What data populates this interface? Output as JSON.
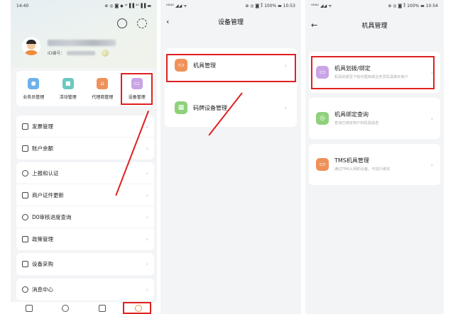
{
  "colors": {
    "accent": "#f08c3c",
    "highlight": "#e02020",
    "purple": "#c9a4e6",
    "green": "#8fd17b",
    "orange": "#f0915a",
    "teal": "#6ac9c0",
    "blue": "#6fb1ea"
  },
  "screen1": {
    "status": {
      "time": "14:40",
      "icons": "⊕ ◎ ◙ ◆ ᵃᵗ▐▐ ⁴ᴳ▐▐ ▬"
    },
    "user": {
      "id_label": "ID编号："
    },
    "shortcuts": [
      {
        "label": "业务员管理",
        "icon": "person-icon"
      },
      {
        "label": "活动管理",
        "icon": "flag-icon"
      },
      {
        "label": "代理商管理",
        "icon": "shop-icon"
      },
      {
        "label": "设备管理",
        "icon": "device-icon"
      }
    ],
    "menu_group1": [
      {
        "label": "发票管理"
      },
      {
        "label": "账户余额"
      }
    ],
    "menu_group2": [
      {
        "label": "上报和认证"
      },
      {
        "label": "商户证件更新"
      },
      {
        "label": "D0审核进度查询"
      },
      {
        "label": "政策管理"
      }
    ],
    "menu_group3": [
      {
        "label": "设备采购"
      }
    ],
    "menu_group4": [
      {
        "label": "消息中心"
      }
    ]
  },
  "screen2": {
    "status": {
      "signal": "ᴴᴰ⁴ᴳ ◢◢ ᯤ",
      "right": "⊕ ◎ ◙ ⁑ 100% ▬ 10:53"
    },
    "title": "设备管理",
    "items": [
      {
        "label": "机具管理"
      },
      {
        "label": "码牌设备管理"
      }
    ]
  },
  "screen3": {
    "status": {
      "signal": "ᴴᴰ⁴ᴳ ◢◢ ᯤ",
      "right": "⊕ ◎ ◙ ⁑ 100% ▬ 10:54"
    },
    "title": "机具管理",
    "items": [
      {
        "title": "机具划拨/绑定",
        "desc": "机具划拨至下级代理商或业务员机具绑定商户"
      },
      {
        "title": "机具绑定查询",
        "desc": "查询已绑定商户的机具信息"
      },
      {
        "title": "TMS机具管理",
        "desc": "通过TMS入网的设备，可进行绑定"
      }
    ]
  }
}
